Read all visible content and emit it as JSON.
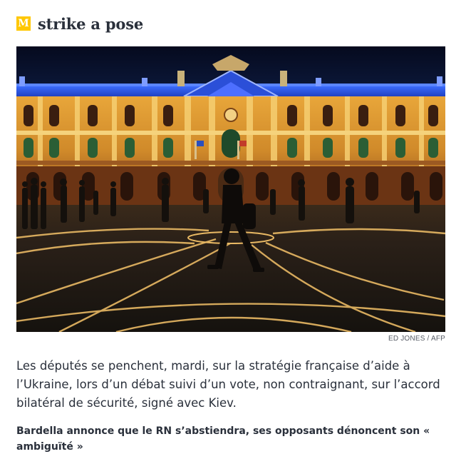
{
  "header": {
    "logo_glyph": "M",
    "title": "strike a pose"
  },
  "photo": {
    "credit": "ED JONES / AFP"
  },
  "article": {
    "lede": "Les députés se penchent, mardi, sur la stratégie française d’aide à l’Ukraine, lors d’un débat suivi d’un vote, non contraignant, sur l’accord bilatéral de sécurité, signé avec Kiev.",
    "related_link": "Bardella annonce que le RN s’abstiendra, ses opposants dénoncent son « ambiguïté »"
  },
  "colors": {
    "logo_accent": "#ffc700",
    "text": "#2a303b",
    "credit": "#555a63"
  }
}
